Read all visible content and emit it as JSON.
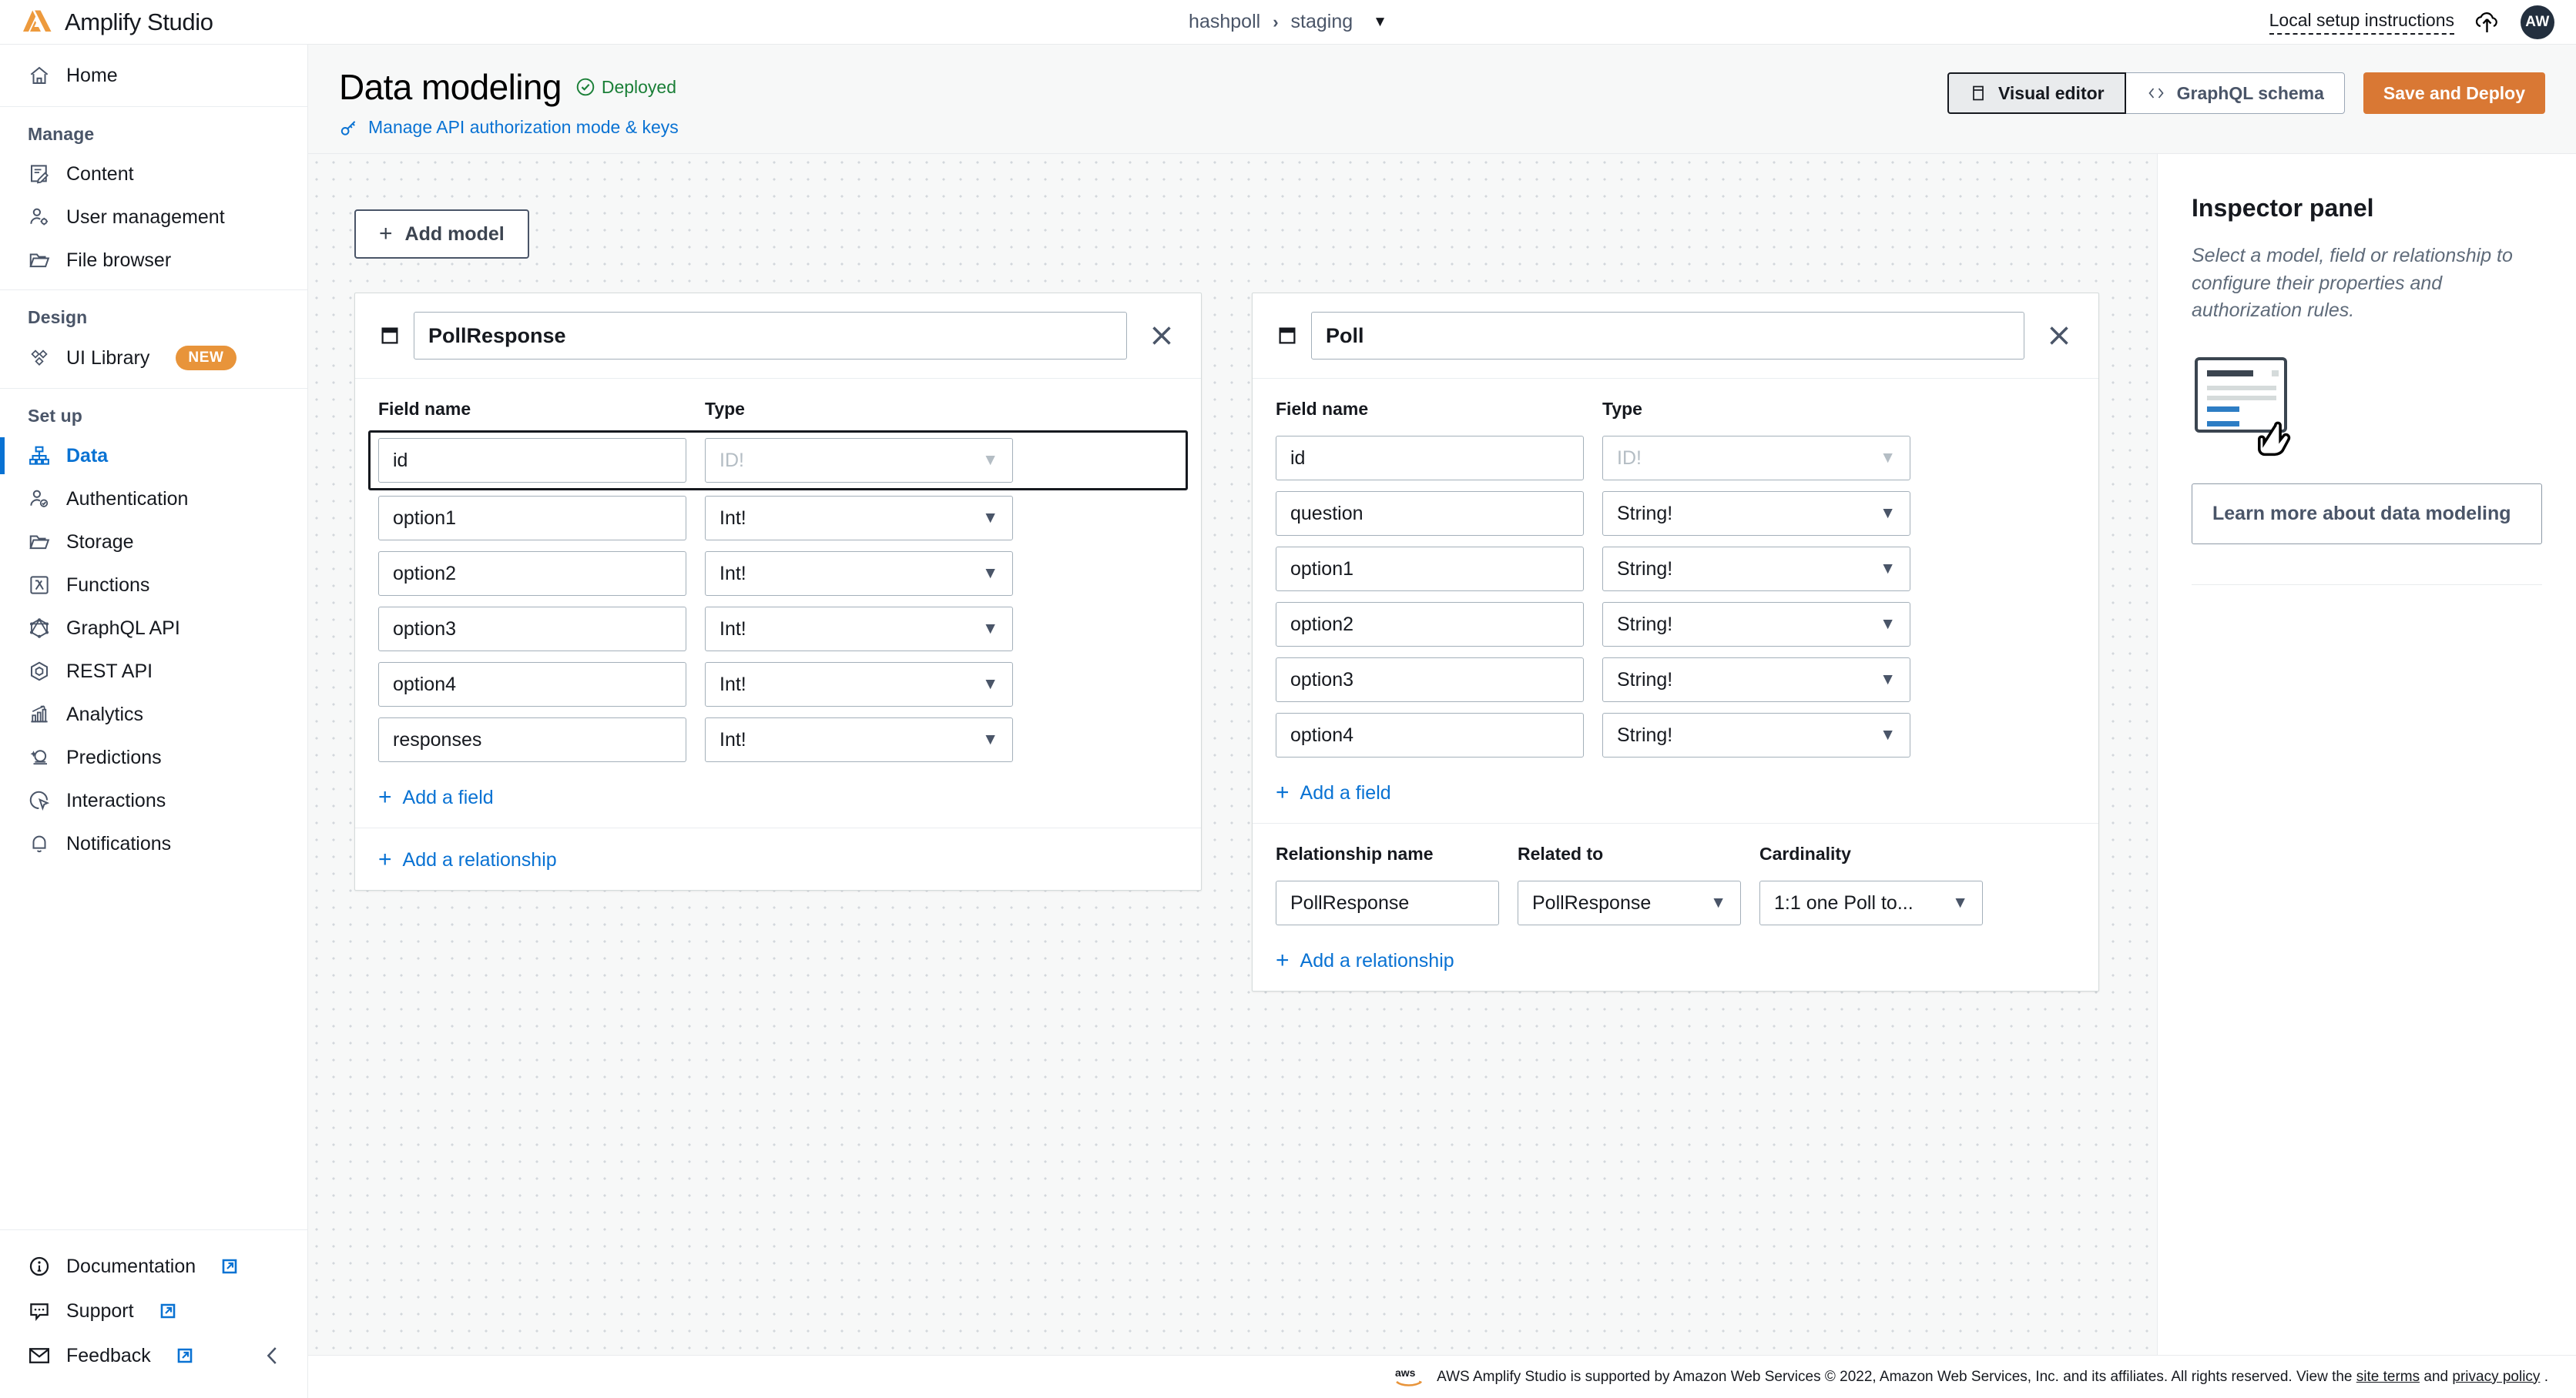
{
  "topbar": {
    "brand": "Amplify Studio",
    "breadcrumb": {
      "app": "hashpoll",
      "separator": "›",
      "env": "staging",
      "caret": "▼"
    },
    "local_setup": "Local setup instructions",
    "avatar_initials": "AW"
  },
  "sidebar": {
    "home": "Home",
    "groups": [
      {
        "title": "Manage",
        "items": [
          {
            "label": "Content",
            "icon": "content-icon"
          },
          {
            "label": "User management",
            "icon": "user-management-icon"
          },
          {
            "label": "File browser",
            "icon": "folder-icon"
          }
        ]
      },
      {
        "title": "Design",
        "items": [
          {
            "label": "UI Library",
            "icon": "ui-library-icon",
            "badge": "NEW"
          }
        ]
      },
      {
        "title": "Set up",
        "items": [
          {
            "label": "Data",
            "icon": "data-icon",
            "active": true
          },
          {
            "label": "Authentication",
            "icon": "authentication-icon"
          },
          {
            "label": "Storage",
            "icon": "folder-icon"
          },
          {
            "label": "Functions",
            "icon": "lambda-icon"
          },
          {
            "label": "GraphQL API",
            "icon": "graphql-icon"
          },
          {
            "label": "REST API",
            "icon": "rest-api-icon"
          },
          {
            "label": "Analytics",
            "icon": "analytics-icon"
          },
          {
            "label": "Predictions",
            "icon": "predictions-icon"
          },
          {
            "label": "Interactions",
            "icon": "interactions-icon"
          },
          {
            "label": "Notifications",
            "icon": "bell-icon"
          }
        ]
      }
    ],
    "footer_items": [
      {
        "label": "Documentation",
        "icon": "info-icon",
        "external": true
      },
      {
        "label": "Support",
        "icon": "support-icon",
        "external": true
      },
      {
        "label": "Feedback",
        "icon": "mail-icon",
        "external": true
      }
    ]
  },
  "page": {
    "title": "Data modeling",
    "status": "Deployed",
    "auth_link": "Manage API authorization mode & keys",
    "tabs": [
      {
        "label": "Visual editor",
        "icon": "panel-icon",
        "active": true
      },
      {
        "label": "GraphQL schema",
        "icon": "code-icon",
        "active": false
      }
    ],
    "save_button": "Save and Deploy"
  },
  "canvas": {
    "add_model": "Add model",
    "add_field": "Add a field",
    "add_relationship": "Add a relationship",
    "column_headers": {
      "field_name": "Field name",
      "type": "Type"
    },
    "relationship_headers": {
      "name": "Relationship name",
      "related_to": "Related to",
      "cardinality": "Cardinality"
    },
    "models": [
      {
        "name": "PollResponse",
        "fields": [
          {
            "name": "id",
            "type": "ID!",
            "disabled": true,
            "focused": true
          },
          {
            "name": "option1",
            "type": "Int!"
          },
          {
            "name": "option2",
            "type": "Int!"
          },
          {
            "name": "option3",
            "type": "Int!"
          },
          {
            "name": "option4",
            "type": "Int!"
          },
          {
            "name": "responses",
            "type": "Int!"
          }
        ],
        "relationships": []
      },
      {
        "name": "Poll",
        "fields": [
          {
            "name": "id",
            "type": "ID!",
            "disabled": true
          },
          {
            "name": "question",
            "type": "String!"
          },
          {
            "name": "option1",
            "type": "String!"
          },
          {
            "name": "option2",
            "type": "String!"
          },
          {
            "name": "option3",
            "type": "String!"
          },
          {
            "name": "option4",
            "type": "String!"
          }
        ],
        "relationships": [
          {
            "name": "PollResponse",
            "related_to": "PollResponse",
            "cardinality": "1:1 one Poll to..."
          }
        ]
      }
    ]
  },
  "inspector": {
    "title": "Inspector panel",
    "description": "Select a model, field or relationship to configure their properties and authorization rules.",
    "learn_more": "Learn more about data modeling"
  },
  "footer": {
    "text_before": "AWS Amplify Studio is supported by Amazon Web Services © 2022, Amazon Web Services, Inc. and its affiliates. All rights reserved. View the ",
    "link1": "site terms",
    "text_middle": " and ",
    "link2": "privacy policy",
    "text_after": " ."
  },
  "colors": {
    "accent_orange": "#d97834",
    "link_blue": "#0972d3",
    "success_green": "#1a7f37",
    "badge_orange": "#e8943a"
  }
}
